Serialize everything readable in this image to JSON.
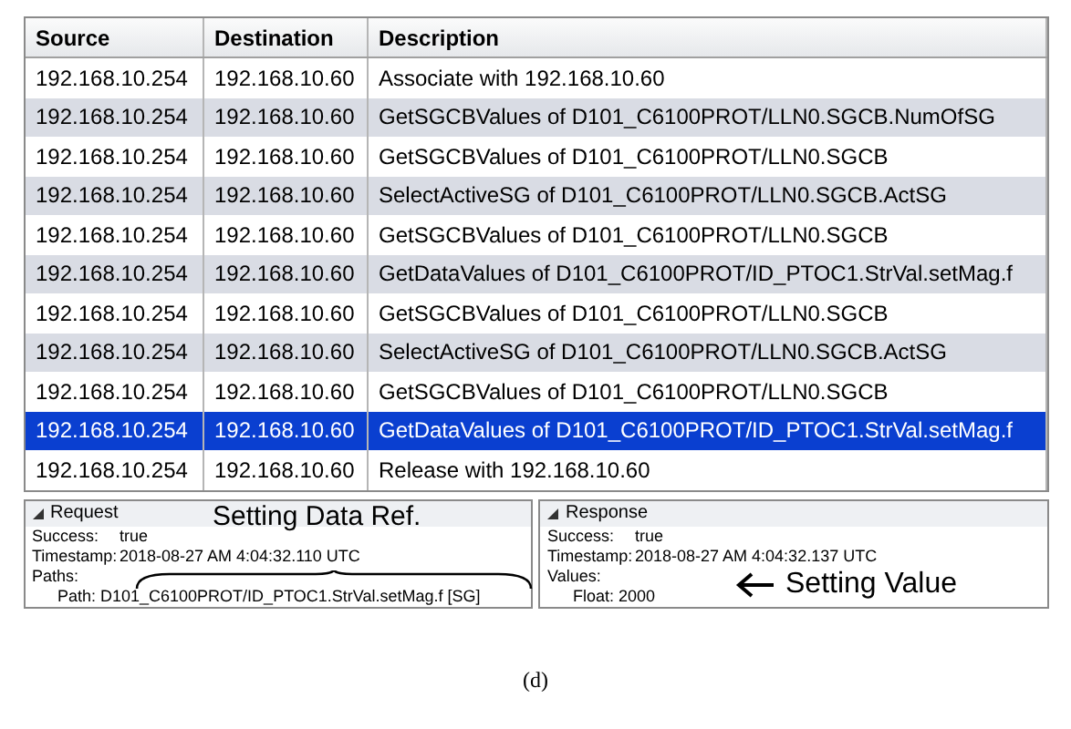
{
  "table": {
    "columns": [
      "Source",
      "Destination",
      "Description"
    ],
    "rows": [
      {
        "cells": [
          "192.168.10.254",
          "192.168.10.60",
          "Associate with 192.168.10.60"
        ],
        "selected": false
      },
      {
        "cells": [
          "192.168.10.254",
          "192.168.10.60",
          "GetSGCBValues of D101_C6100PROT/LLN0.SGCB.NumOfSG"
        ],
        "selected": false
      },
      {
        "cells": [
          "192.168.10.254",
          "192.168.10.60",
          "GetSGCBValues of D101_C6100PROT/LLN0.SGCB"
        ],
        "selected": false
      },
      {
        "cells": [
          "192.168.10.254",
          "192.168.10.60",
          "SelectActiveSG of D101_C6100PROT/LLN0.SGCB.ActSG"
        ],
        "selected": false
      },
      {
        "cells": [
          "192.168.10.254",
          "192.168.10.60",
          "GetSGCBValues of D101_C6100PROT/LLN0.SGCB"
        ],
        "selected": false
      },
      {
        "cells": [
          "192.168.10.254",
          "192.168.10.60",
          "GetDataValues of D101_C6100PROT/ID_PTOC1.StrVal.setMag.f"
        ],
        "selected": false
      },
      {
        "cells": [
          "192.168.10.254",
          "192.168.10.60",
          "GetSGCBValues of D101_C6100PROT/LLN0.SGCB"
        ],
        "selected": false
      },
      {
        "cells": [
          "192.168.10.254",
          "192.168.10.60",
          "SelectActiveSG of D101_C6100PROT/LLN0.SGCB.ActSG"
        ],
        "selected": false
      },
      {
        "cells": [
          "192.168.10.254",
          "192.168.10.60",
          "GetSGCBValues of D101_C6100PROT/LLN0.SGCB"
        ],
        "selected": false
      },
      {
        "cells": [
          "192.168.10.254",
          "192.168.10.60",
          "GetDataValues of D101_C6100PROT/ID_PTOC1.StrVal.setMag.f"
        ],
        "selected": true
      },
      {
        "cells": [
          "192.168.10.254",
          "192.168.10.60",
          "Release with 192.168.10.60"
        ],
        "selected": false
      }
    ]
  },
  "request": {
    "title": "Request",
    "expanded": true,
    "fields": [
      {
        "label": "Success:",
        "value": "true"
      },
      {
        "label": "Timestamp:",
        "value": "2018-08-27 AM 4:04:32.110 UTC"
      },
      {
        "label": "Paths:",
        "value": "Path: D101_C6100PROT/ID_PTOC1.StrVal.setMag.f [SG]"
      }
    ],
    "annotation": "Setting Data Ref."
  },
  "response": {
    "title": "Response",
    "expanded": true,
    "fields": [
      {
        "label": "Success:",
        "value": "true"
      },
      {
        "label": "Timestamp:",
        "value": "2018-08-27 AM 4:04:32.137 UTC"
      },
      {
        "label": "Values:",
        "value": "Float: 2000"
      }
    ],
    "annotation": "Setting Value"
  },
  "caption": "(d)"
}
